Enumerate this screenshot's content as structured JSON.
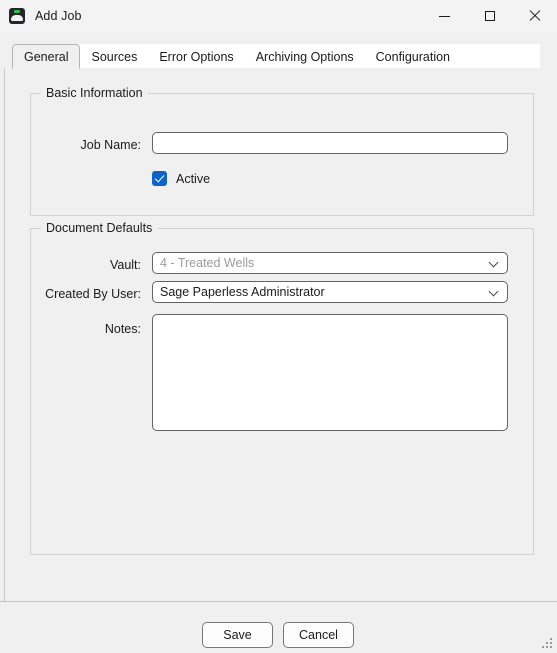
{
  "window": {
    "title": "Add Job",
    "icon": "sage-paperless-icon",
    "controls": {
      "minimize": "minimize-icon",
      "maximize": "maximize-icon",
      "close": "close-icon"
    }
  },
  "tabs": [
    {
      "label": "General",
      "selected": true
    },
    {
      "label": "Sources",
      "selected": false
    },
    {
      "label": "Error Options",
      "selected": false
    },
    {
      "label": "Archiving Options",
      "selected": false
    },
    {
      "label": "Configuration",
      "selected": false
    }
  ],
  "basic_information": {
    "title": "Basic Information",
    "job_name": {
      "label": "Job Name:",
      "value": "",
      "placeholder": ""
    },
    "active": {
      "label": "Active",
      "checked": true,
      "color": "#0f62c8"
    }
  },
  "document_defaults": {
    "title": "Document Defaults",
    "vault": {
      "label": "Vault:",
      "value": "4 - Treated Wells",
      "disabled": true
    },
    "created_by_user": {
      "label": "Created By User:",
      "value": "Sage Paperless  Administrator",
      "disabled": false
    },
    "notes": {
      "label": "Notes:",
      "value": "",
      "placeholder": ""
    }
  },
  "footer": {
    "save_label": "Save",
    "cancel_label": "Cancel"
  }
}
